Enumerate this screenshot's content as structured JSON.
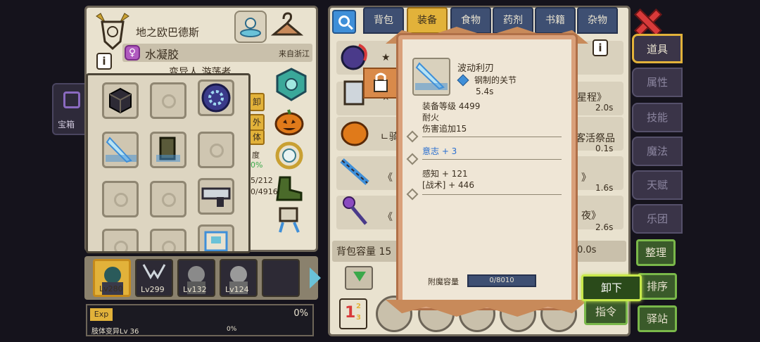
{
  "left_bg_tab": {
    "label": "宝箱"
  },
  "character": {
    "name": "地之欧巴德斯",
    "title": "水凝胶",
    "origin": "来自浙江",
    "subtitle": "变异人 游荡者",
    "stat_buttons": [
      "卸",
      "外",
      "体"
    ],
    "partial_stats": [
      "度",
      "0%",
      "5/212",
      "0/4916"
    ]
  },
  "party": {
    "heroes": [
      {
        "level": "Lv280",
        "selected": true
      },
      {
        "level": "Lv299",
        "selected": false
      },
      {
        "level": "Lv132",
        "selected": false
      },
      {
        "level": "Lv124",
        "selected": false
      },
      {
        "level": "",
        "selected": false
      }
    ]
  },
  "exp": {
    "label": "Exp",
    "percent": "0%",
    "sub_label": "肢体变异Lv 36",
    "sub_percent": "0%"
  },
  "inventory": {
    "tabs": [
      "背包",
      "装备",
      "食物",
      "药剂",
      "书籍",
      "杂物"
    ],
    "active_tab": "装备",
    "rows": [
      {
        "name": "",
        "time": ""
      },
      {
        "name": "星程》",
        "time": "2.0s"
      },
      {
        "name": "客活祭品",
        "time": "0.1s"
      },
      {
        "name": "》",
        "time": "1.6s"
      },
      {
        "name": "夜》",
        "time": "2.6s"
      }
    ],
    "row_prefixes": [
      "★",
      "★",
      "ㄴ骑",
      "《",
      "《"
    ],
    "capacity_label": "背包容量 15",
    "capacity_time": "0.0s"
  },
  "tooltip": {
    "item_name": "波动利刃",
    "attr_name": "钢制的关节",
    "attr_time": "5.4s",
    "lines": [
      "装备等级 4499",
      "耐火",
      "伤害追加15"
    ],
    "will": "意志 + 3",
    "stats": [
      "感知 + 121",
      "[战术] + 446"
    ],
    "enchant_label": "附魔容量",
    "enchant_value": "0/8010"
  },
  "right_tabs": [
    "道具",
    "属性",
    "技能",
    "魔法",
    "天赋",
    "乐团"
  ],
  "active_right_tab": "道具",
  "action_buttons": {
    "organize": "整理",
    "sort": "排序",
    "station": "驿站",
    "unequip": "卸下",
    "command": "指令"
  },
  "colors": {
    "gold": "#e2b23a",
    "navy_tab": "#3e4f72",
    "parchment": "#e9e2cf",
    "close_red": "#d83a3a",
    "green_btn": "#7ab84a"
  }
}
